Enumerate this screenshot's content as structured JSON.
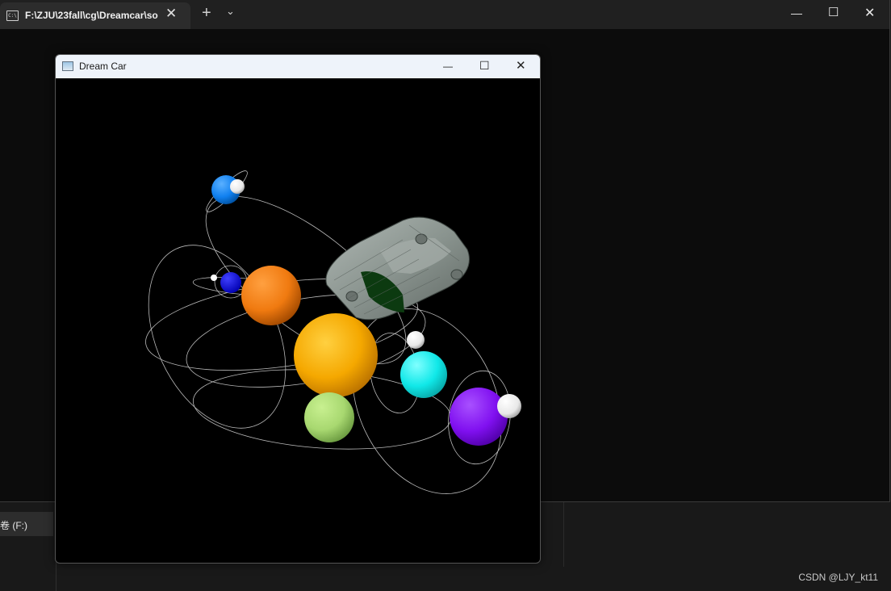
{
  "terminal": {
    "tab_title": "F:\\ZJU\\23fall\\cg\\Dreamcar\\so",
    "tab_icon": "C:\\",
    "new_tab": "+",
    "dropdown": "⌄",
    "close": "✕",
    "minimize": "—",
    "maximize": "☐"
  },
  "explorer": {
    "drive_label": "卷 (F:)"
  },
  "watermark": "CSDN @LJY_kt11",
  "glwindow": {
    "title": "Dream Car",
    "minimize": "—",
    "maximize": "☐",
    "close": "✕"
  },
  "scene": {
    "background": "#000000",
    "objects": [
      {
        "name": "sun",
        "color": "#f5a800"
      },
      {
        "name": "orange-planet",
        "color": "#f07a10"
      },
      {
        "name": "blue-planet",
        "color": "#1080f0"
      },
      {
        "name": "dark-blue-planet",
        "color": "#1010f0"
      },
      {
        "name": "light-green-planet",
        "color": "#a8d870"
      },
      {
        "name": "cyan-planet",
        "color": "#10e8e8"
      },
      {
        "name": "purple-planet",
        "color": "#8010f0"
      },
      {
        "name": "car",
        "color": "#8a948f"
      }
    ]
  }
}
